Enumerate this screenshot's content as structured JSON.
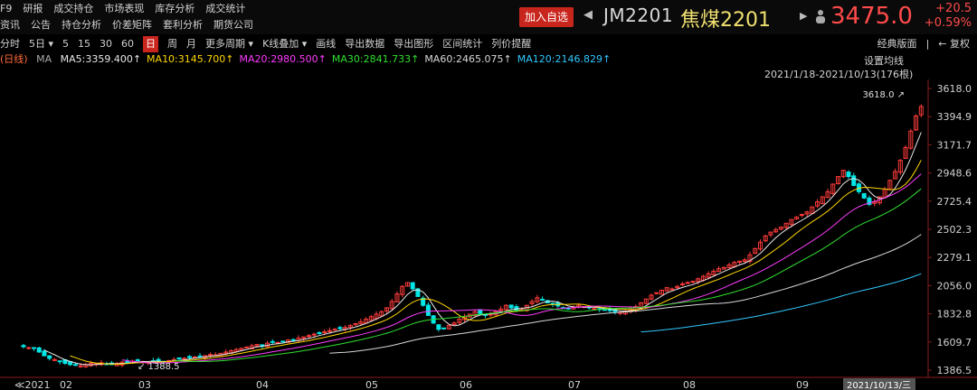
{
  "menu": {
    "row1": [
      "F9",
      "研报",
      "成交持仓",
      "市场表现",
      "库存分析",
      "成交统计"
    ],
    "row2": [
      "资讯",
      "公告",
      "持仓分析",
      "价差矩阵",
      "套利分析",
      "期货公司"
    ]
  },
  "header": {
    "add_watch": "加入自选",
    "code": "JM2201",
    "name": "焦煤2201",
    "price": "3475.0",
    "change": "+20.5",
    "change_pct": "+0.59%"
  },
  "toolbar": {
    "items": [
      "分时",
      "5日 ▾",
      "5",
      "15",
      "30",
      "60",
      "日",
      "周",
      "月",
      "更多周期 ▾",
      "K线叠加 ▾",
      "画线",
      "导出数据",
      "导出图形",
      "区间统计",
      "列价提醒"
    ],
    "selected_index": 6,
    "right": [
      "经典版面",
      "|",
      "← 复权"
    ]
  },
  "ma_legend": {
    "prefix": "(日线)",
    "ma_label": "MA",
    "items": [
      {
        "text": "MA5:3359.400↑",
        "color": "#e8e8e8"
      },
      {
        "text": "MA10:3145.700↑",
        "color": "#ffd700"
      },
      {
        "text": "MA20:2980.500↑",
        "color": "#ff3cff"
      },
      {
        "text": "MA30:2841.733↑",
        "color": "#30e030"
      },
      {
        "text": "MA60:2465.075↑",
        "color": "#d8d8d8"
      },
      {
        "text": "MA120:2146.829↑",
        "color": "#30c8ff"
      }
    ],
    "settings_label": "设置均线"
  },
  "range_label": "2021/1/18-2021/10/13(176根)",
  "chart_data": {
    "type": "candlestick",
    "y_ticks": [
      "3618.0",
      "3394.9",
      "3171.7",
      "2948.6",
      "2725.4",
      "2502.3",
      "2279.1",
      "2056.0",
      "1832.8",
      "1609.7",
      "1386.5"
    ],
    "y_range": [
      1386.5,
      3618.0
    ],
    "x_labels": [
      "2021",
      "02",
      "03",
      "04",
      "05",
      "06",
      "07",
      "08",
      "09"
    ],
    "cursor_date": "2021/10/13/三",
    "max_label": "3618.0",
    "min_label": "1388.5",
    "colors": {
      "up": "#ff3b3b",
      "down": "#00e5e5",
      "ma5": "#e8e8e8",
      "ma10": "#ffd700",
      "ma20": "#ff3cff",
      "ma30": "#30e030",
      "ma60": "#d8d8d8",
      "ma120": "#30c8ff"
    },
    "closes": [
      1572,
      1565,
      1560,
      1530,
      1500,
      1480,
      1470,
      1455,
      1440,
      1430,
      1425,
      1420,
      1432,
      1440,
      1438,
      1445,
      1435,
      1430,
      1440,
      1450,
      1448,
      1458,
      1462,
      1455,
      1450,
      1460,
      1455,
      1450,
      1462,
      1470,
      1475,
      1480,
      1485,
      1490,
      1496,
      1502,
      1510,
      1508,
      1520,
      1530,
      1540,
      1550,
      1560,
      1570,
      1580,
      1590,
      1575,
      1600,
      1610,
      1605,
      1615,
      1625,
      1620,
      1640,
      1650,
      1660,
      1672,
      1680,
      1690,
      1700,
      1710,
      1715,
      1725,
      1740,
      1755,
      1770,
      1790,
      1810,
      1830,
      1850,
      1880,
      1930,
      1990,
      2050,
      2080,
      2030,
      1970,
      1900,
      1820,
      1760,
      1710,
      1720,
      1740,
      1760,
      1790,
      1810,
      1830,
      1850,
      1835,
      1820,
      1830,
      1850,
      1870,
      1900,
      1880,
      1860,
      1870,
      1900,
      1930,
      1960,
      1945,
      1920,
      1910,
      1895,
      1880,
      1870,
      1885,
      1900,
      1890,
      1880,
      1875,
      1870,
      1860,
      1858,
      1850,
      1845,
      1855,
      1870,
      1890,
      1920,
      1950,
      1980,
      2000,
      2020,
      2040,
      2030,
      2050,
      2070,
      2080,
      2090,
      2110,
      2130,
      2150,
      2170,
      2190,
      2200,
      2220,
      2240,
      2250,
      2260,
      2300,
      2350,
      2400,
      2450,
      2480,
      2500,
      2520,
      2550,
      2580,
      2600,
      2620,
      2640,
      2680,
      2720,
      2760,
      2800,
      2860,
      2920,
      2970,
      2920,
      2850,
      2800,
      2750,
      2700,
      2720,
      2760,
      2820,
      2890,
      2960,
      3050,
      3150,
      3280,
      3400,
      3475
    ]
  }
}
